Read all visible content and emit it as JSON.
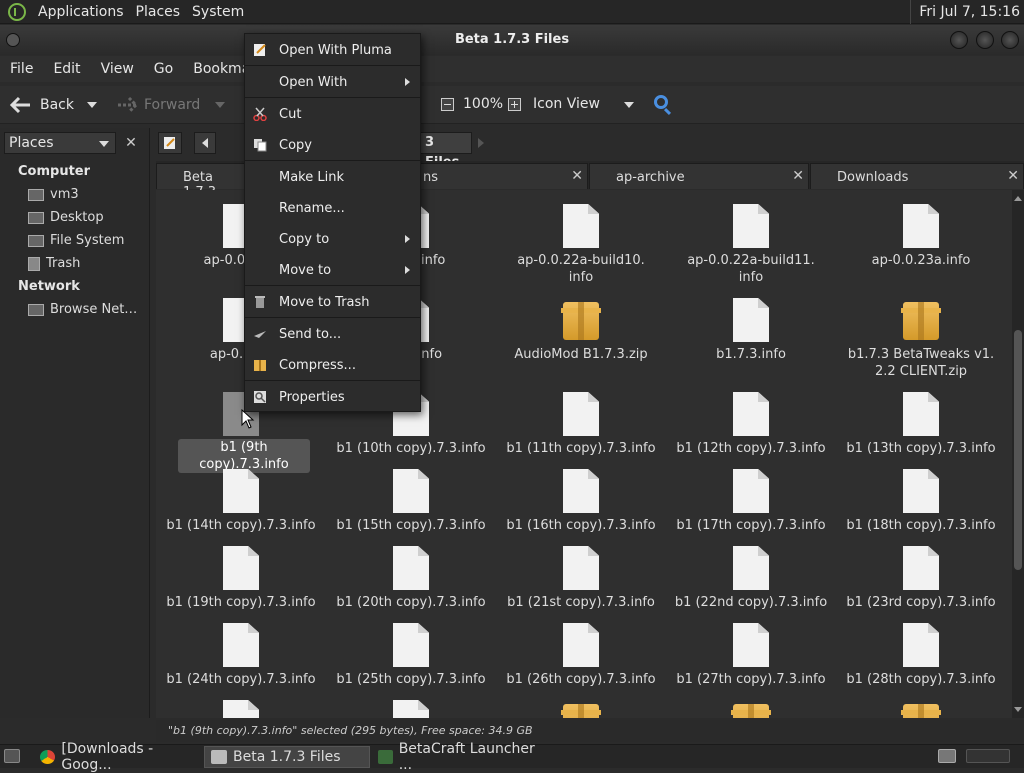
{
  "top_panel": {
    "menus": [
      "Applications",
      "Places",
      "System"
    ],
    "clock": "Fri Jul  7, 15:16"
  },
  "window": {
    "title": "Beta 1.7.3 Files"
  },
  "menubar": [
    "File",
    "Edit",
    "View",
    "Go",
    "Bookmark"
  ],
  "toolbar": {
    "back": "Back",
    "forward": "Forward",
    "zoom": "100%",
    "view_mode": "Icon View"
  },
  "sidebar": {
    "selector": "Places",
    "computer_header": "Computer",
    "computer_items": [
      "vm3",
      "Desktop",
      "File System",
      "Trash"
    ],
    "network_header": "Network",
    "network_items": [
      "Browse Net…"
    ]
  },
  "location": {
    "current": "3 Files"
  },
  "tabs": [
    {
      "label": "Beta 1.7.3"
    },
    {
      "label": "ns"
    },
    {
      "label": "ap-archive"
    },
    {
      "label": "Downloads"
    }
  ],
  "files": [
    [
      "ap-0.0.22a-",
      "build9.info",
      "ap-0.0.22a-build10.",
      "ap-0.0.22a-build11.",
      "ap-0.0.23a.info"
    ],
    [
      "ap-0.0.23",
      ".01-2.info",
      "AudioMod B1.7.3.zip",
      "b1.7.3.info",
      "b1.7.3 BetaTweaks v1."
    ],
    [
      "b1 (9th copy).7.3.info",
      "b1 (10th copy).7.3.info",
      "b1 (11th copy).7.3.info",
      "b1 (12th copy).7.3.info",
      "b1 (13th copy).7.3.info"
    ],
    [
      "b1 (14th copy).7.3.info",
      "b1 (15th copy).7.3.info",
      "b1 (16th copy).7.3.info",
      "b1 (17th copy).7.3.info",
      "b1 (18th copy).7.3.info"
    ],
    [
      "b1 (19th copy).7.3.info",
      "b1 (20th copy).7.3.info",
      "b1 (21st copy).7.3.info",
      "b1 (22nd copy).7.3.info",
      "b1 (23rd copy).7.3.info"
    ],
    [
      "b1 (24th copy).7.3.info",
      "b1 (25th copy).7.3.info",
      "b1 (26th copy).7.3.info",
      "b1 (27th copy).7.3.info",
      "b1 (28th copy).7.3.info"
    ]
  ],
  "files_second_line": {
    "r0c2": "info",
    "r0c3": "info",
    "r1c4": "2.2 CLIENT.zip"
  },
  "status": "\"b1 (9th copy).7.3.info\" selected (295 bytes), Free space: 34.9 GB",
  "context_menu": {
    "open_with_pluma": "Open With Pluma",
    "open_with": "Open With",
    "cut": "Cut",
    "copy": "Copy",
    "make_link": "Make Link",
    "rename": "Rename...",
    "copy_to": "Copy to",
    "move_to": "Move to",
    "move_to_trash": "Move to Trash",
    "send_to": "Send to...",
    "compress": "Compress...",
    "properties": "Properties"
  },
  "taskbar": [
    {
      "label": "[Downloads - Goog..."
    },
    {
      "label": "Beta 1.7.3 Files"
    },
    {
      "label": "BetaCraft Launcher ..."
    }
  ],
  "colors": {
    "accent": "#4a8fe0",
    "selection": "#555555",
    "zip": "#e8b34a"
  }
}
